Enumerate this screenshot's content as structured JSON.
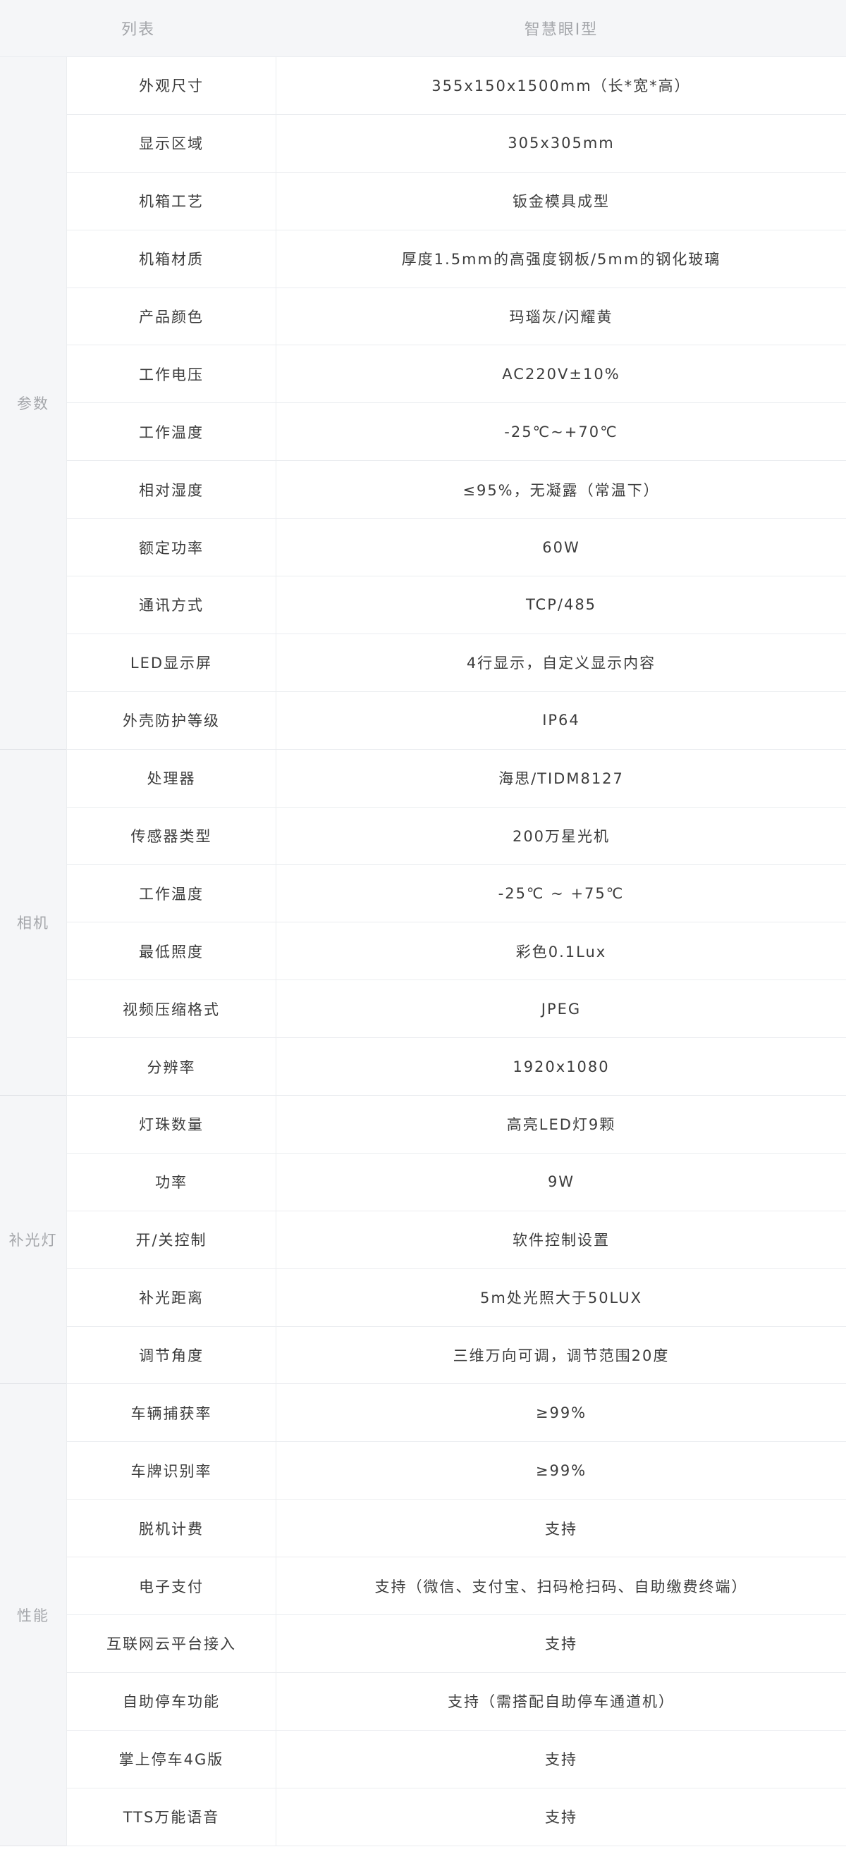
{
  "header": {
    "col1": "列表",
    "col2": "智慧眼I型"
  },
  "groups": [
    {
      "name": "参数",
      "rows": [
        {
          "label": "外观尺寸",
          "value": "355x150x1500mm（长*宽*高）"
        },
        {
          "label": "显示区域",
          "value": "305x305mm"
        },
        {
          "label": "机箱工艺",
          "value": "钣金模具成型"
        },
        {
          "label": "机箱材质",
          "value": "厚度1.5mm的高强度钢板/5mm的钢化玻璃"
        },
        {
          "label": "产品颜色",
          "value": "玛瑙灰/闪耀黄"
        },
        {
          "label": "工作电压",
          "value": "AC220V±10%"
        },
        {
          "label": "工作温度",
          "value": "-25℃~+70℃"
        },
        {
          "label": "相对湿度",
          "value": "≤95%，无凝露（常温下）"
        },
        {
          "label": "额定功率",
          "value": "60W"
        },
        {
          "label": "通讯方式",
          "value": "TCP/485"
        },
        {
          "label": "LED显示屏",
          "value": "4行显示，自定义显示内容"
        },
        {
          "label": "外壳防护等级",
          "value": "IP64"
        }
      ]
    },
    {
      "name": "相机",
      "rows": [
        {
          "label": "处理器",
          "value": "海思/TIDM8127"
        },
        {
          "label": "传感器类型",
          "value": "200万星光机"
        },
        {
          "label": "工作温度",
          "value": "-25℃ ~ +75℃"
        },
        {
          "label": "最低照度",
          "value": "彩色0.1Lux"
        },
        {
          "label": "视频压缩格式",
          "value": "JPEG"
        },
        {
          "label": "分辨率",
          "value": "1920x1080"
        }
      ]
    },
    {
      "name": "补光灯",
      "rows": [
        {
          "label": "灯珠数量",
          "value": "高亮LED灯9颗"
        },
        {
          "label": "功率",
          "value": "9W"
        },
        {
          "label": "开/关控制",
          "value": "软件控制设置"
        },
        {
          "label": "补光距离",
          "value": "5m处光照大于50LUX"
        },
        {
          "label": "调节角度",
          "value": "三维万向可调，调节范围20度"
        }
      ]
    },
    {
      "name": "性能",
      "rows": [
        {
          "label": "车辆捕获率",
          "value": "≥99%"
        },
        {
          "label": "车牌识别率",
          "value": "≥99%"
        },
        {
          "label": "脱机计费",
          "value": "支持"
        },
        {
          "label": "电子支付",
          "value": "支持（微信、支付宝、扫码枪扫码、自助缴费终端）"
        },
        {
          "label": "互联网云平台接入",
          "value": "支持"
        },
        {
          "label": "自助停车功能",
          "value": "支持（需搭配自助停车通道机）"
        },
        {
          "label": "掌上停车4G版",
          "value": "支持"
        },
        {
          "label": "TTS万能语音",
          "value": "支持"
        }
      ]
    }
  ]
}
